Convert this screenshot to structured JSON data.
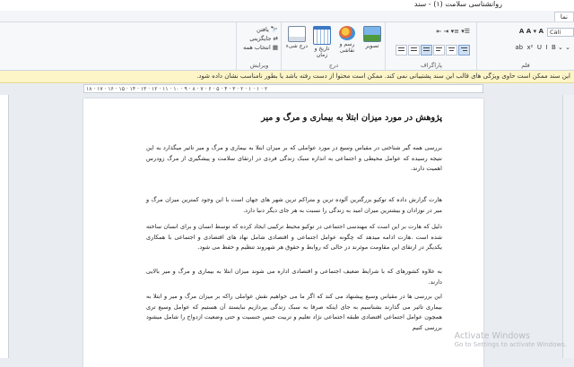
{
  "window": {
    "title": "روانشناسی سلامت (۱) - سند"
  },
  "tabs": [
    {
      "label": "نما",
      "active": false
    }
  ],
  "ribbon": {
    "font_group_label": "قلم",
    "font_name": "Cali",
    "paragraph_group_label": "پاراگراف",
    "insert_group_label": "درج",
    "edit_group_label": "ویرایش",
    "insert_buttons": [
      {
        "label": "تصویر",
        "icon": "image-icon"
      },
      {
        "label": "رسم و نقاشی",
        "icon": "paint-icon"
      },
      {
        "label": "تاریخ و زمان",
        "icon": "calendar-icon"
      },
      {
        "label": "درج شیء",
        "icon": "object-icon"
      }
    ],
    "edit_items": [
      {
        "label": "یافتن",
        "icon": "binoculars-icon"
      },
      {
        "label": "جایگزینی",
        "icon": "replace-icon"
      },
      {
        "label": "انتخاب همه",
        "icon": "select-all-icon"
      }
    ]
  },
  "message_bar": {
    "text": "این سند ممکن است حاوی ویژگی های قالب این سند پشتیبانی نمی کند. ممکن است محتوا از دست رفته باشد یا بطور نامناسب نشان داده شود."
  },
  "ruler": {
    "numbers": "۱۸ · ۱۷ · ۱۶ · ۱۵ · ۱۴ · ۱۳ · ۱۲ · ۱۱ · ۱۰ · ۹ · ۸ · ۷ · ۶ · ۵ · ۴ · ۳ · ۲ · ۱ · ۱ · ۲"
  },
  "document": {
    "heading": "پژوهش در مورد میزان ابتلا به بیماری و مرگ و میر",
    "paragraphs": [
      "بررسی همه گیر شناختی در مقیاس وسیع در مورد عواملی که بر میزان ابتلا به بیماری و مرگ و میر تاثیر میگذارد به این نتیجه رسیده که عوامل محیطی و اجتماعی به اندازه سبک زندگی فردی در ارتقای سلامت و پیشگیری از مرگ زودرس اهمیت دارند.",
      "هارت گزارش داده که توکیو بزرگترین  آلوده ترین و متراکم ترین شهر های جهان است با این وجود کمترین میزان مرگ و میر در نوزادان و بیشترین میزان امید به زندگی را نسبت به هر جای دیگر دنیا دارد.",
      "دلیل که هارت بر این است که مهندسی اجتماعی در توکیو محیط ترکیبی ایجاد کرده که توسط انسان و برای انسان ساخته شده است .هارت ادامه میدهد که چگونه عوامل اجتماعی و اقتصادی شامل نهاد های اقتصادی و اجتماعی با همکاری یکدیگر در ارتقای این مقاومت موثرند در حالی که روابط و حقوق هر شهروند تنظیم و حفظ می شود.",
      "به علاوه کشورهای که با شرایط ضعیف اجتماعی و اقتصادی اداره می شوند میزان ابتلا به بیماری و مرگ و میر بالایی دارند.",
      "این بررسی ها در مقیاس وسیع  پیشنهاد می کند که اگر ما می خواهیم نقش عواملی راکه بر میزان مرگ و میر  و ابتلا به بیماری تاثیر می گذارند بشناسیم به جای اینکه صرفا به سبک زندگی بپردازیم نبایستد آن هستیم که عوامل وسیع تری همچون عوامل اجتماعی اقتصادی  طبقه اجتماعی  نژاد  تعلیم و تربیت جنس  جنسیت  و حتی وضعیت ازدواج را شامل میشود بررسی کنیم"
    ]
  },
  "watermark": {
    "line1": "Activate Windows",
    "line2": "Go to Settings to activate Windows."
  },
  "colors": {
    "message_bg": "#fdf5c7",
    "ribbon_bg": "#f7f8fa",
    "page_bg": "#ffffff"
  }
}
